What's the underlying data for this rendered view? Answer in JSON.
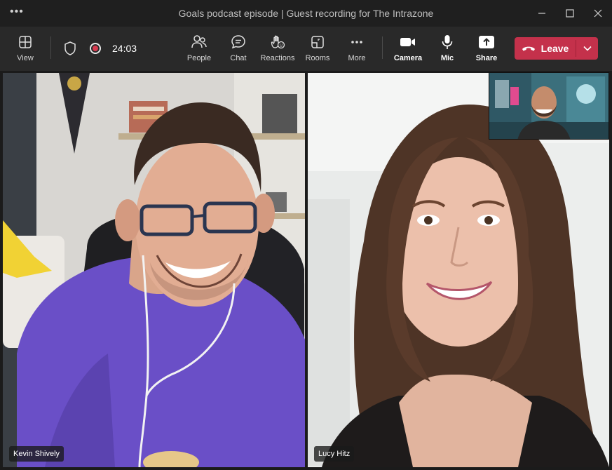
{
  "window": {
    "title": "Goals podcast episode | Guest recording for The Intrazone",
    "menu_glyph": "•••"
  },
  "toolbar": {
    "view_label": "View",
    "timer": "24:03",
    "people_label": "People",
    "chat_label": "Chat",
    "reactions_label": "Reactions",
    "rooms_label": "Rooms",
    "more_label": "More",
    "camera_label": "Camera",
    "mic_label": "Mic",
    "share_label": "Share",
    "leave_label": "Leave"
  },
  "participants": [
    {
      "name": "Kevin Shively"
    },
    {
      "name": "Lucy Hitz"
    }
  ],
  "colors": {
    "accent_leave": "#c4314b",
    "recording": "#d83b50",
    "toolbar_bg": "#292929"
  }
}
